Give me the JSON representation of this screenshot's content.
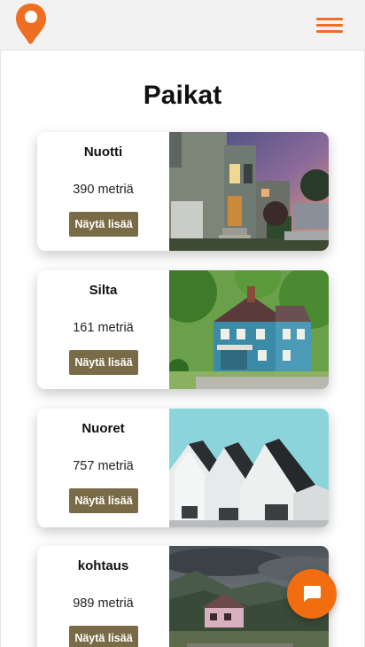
{
  "header": {
    "logo_icon": "map-pin-icon",
    "menu_icon": "hamburger-menu-icon",
    "accent_color": "#ef6f22"
  },
  "page": {
    "title": "Paikat"
  },
  "places": [
    {
      "name": "Nuotti",
      "distance": "390 metriä",
      "button": "Näytä lisää",
      "image": "modern-house-photo"
    },
    {
      "name": "Silta",
      "distance": "161 metriä",
      "button": "Näytä lisää",
      "image": "blue-house-photo"
    },
    {
      "name": "Nuoret",
      "distance": "757 metriä",
      "button": "Näytä lisää",
      "image": "gabled-houses-photo"
    },
    {
      "name": "kohtaus",
      "distance": "989 metriä",
      "button": "Näytä lisää",
      "image": "mountain-cabin-photo"
    }
  ],
  "chat": {
    "icon": "chat-bubble-icon",
    "color": "#f26d0f"
  },
  "colors": {
    "button_bg": "#7a6b47"
  }
}
